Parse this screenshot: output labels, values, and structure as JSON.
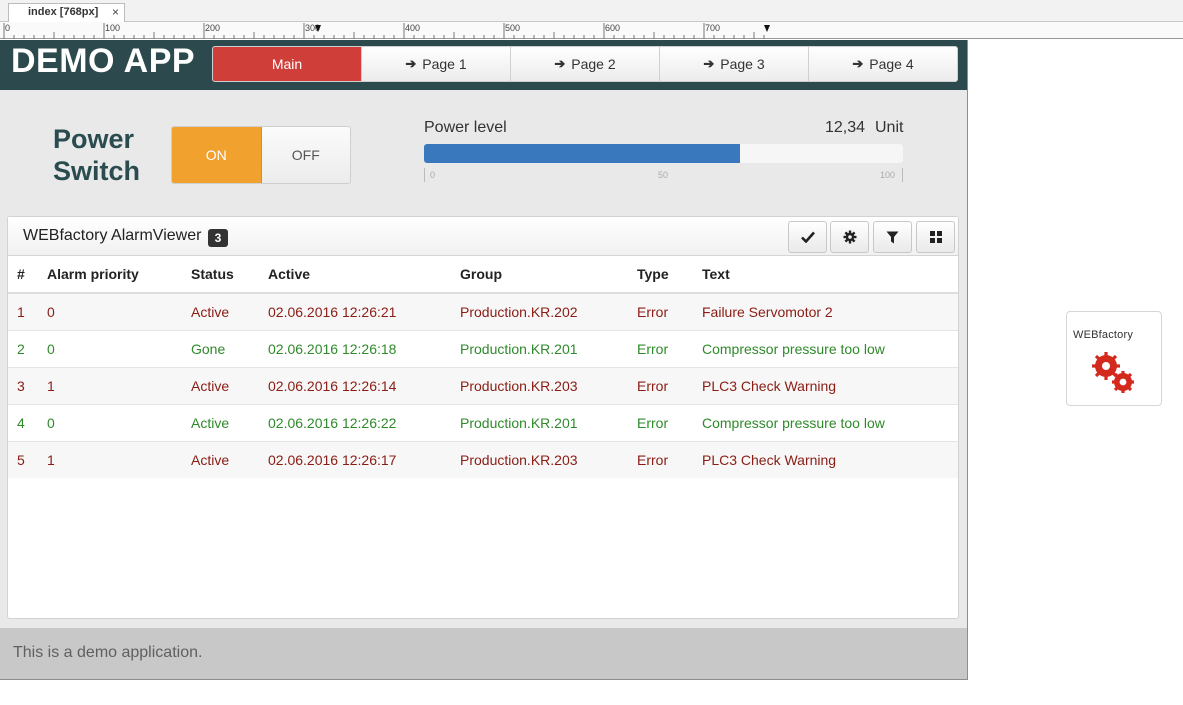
{
  "editor": {
    "tab_label": "index [768px]",
    "tab_close": "×",
    "ruler_labels": [
      "0",
      "100",
      "200",
      "300",
      "400",
      "500",
      "600",
      "700"
    ]
  },
  "app": {
    "title": "DEMO APP",
    "nav": [
      {
        "label": "Main",
        "active": true,
        "arrow": ""
      },
      {
        "label": "Page 1",
        "active": false,
        "arrow": "➔"
      },
      {
        "label": "Page 2",
        "active": false,
        "arrow": "➔"
      },
      {
        "label": "Page 3",
        "active": false,
        "arrow": "➔"
      },
      {
        "label": "Page 4",
        "active": false,
        "arrow": "➔"
      }
    ],
    "header_color": "#2c4a4d",
    "active_nav_color": "#d03e3a"
  },
  "power_switch": {
    "label_line1": "Power",
    "label_line2": "Switch",
    "on_label": "ON",
    "off_label": "OFF",
    "state": "ON",
    "on_color": "#f0a12e"
  },
  "power_level": {
    "label": "Power level",
    "value_text": "12,34",
    "unit": "Unit",
    "fill_percent": 66,
    "scale": {
      "min": "0",
      "mid": "50",
      "max": "100"
    },
    "bar_color": "#3a78bd"
  },
  "alarm_viewer": {
    "title": "WEBfactory AlarmViewer",
    "badge": "3",
    "tools": [
      "check-icon",
      "gear-icon",
      "filter-icon",
      "grid-icon"
    ],
    "columns": [
      "#",
      "Alarm priority",
      "Status",
      "Active",
      "Group",
      "Type",
      "Text"
    ],
    "rows": [
      {
        "num": "1",
        "priority": "0",
        "status": "Active",
        "active": "02.06.2016 12:26:21",
        "group": "Production.KR.202",
        "type": "Error",
        "text": "Failure Servomotor 2",
        "color": "red"
      },
      {
        "num": "2",
        "priority": "0",
        "status": "Gone",
        "active": "02.06.2016 12:26:18",
        "group": "Production.KR.201",
        "type": "Error",
        "text": "Compressor pressure too low",
        "color": "green"
      },
      {
        "num": "3",
        "priority": "1",
        "status": "Active",
        "active": "02.06.2016 12:26:14",
        "group": "Production.KR.203",
        "type": "Error",
        "text": "PLC3 Check Warning",
        "color": "red"
      },
      {
        "num": "4",
        "priority": "0",
        "status": "Active",
        "active": "02.06.2016 12:26:22",
        "group": "Production.KR.201",
        "type": "Error",
        "text": "Compressor pressure too low",
        "color": "green"
      },
      {
        "num": "5",
        "priority": "1",
        "status": "Active",
        "active": "02.06.2016 12:26:17",
        "group": "Production.KR.203",
        "type": "Error",
        "text": "PLC3 Check Warning",
        "color": "red"
      }
    ]
  },
  "footer": {
    "text": "This is a demo application."
  },
  "logo": {
    "text": "WEBfactory",
    "icon": "gears-icon"
  }
}
